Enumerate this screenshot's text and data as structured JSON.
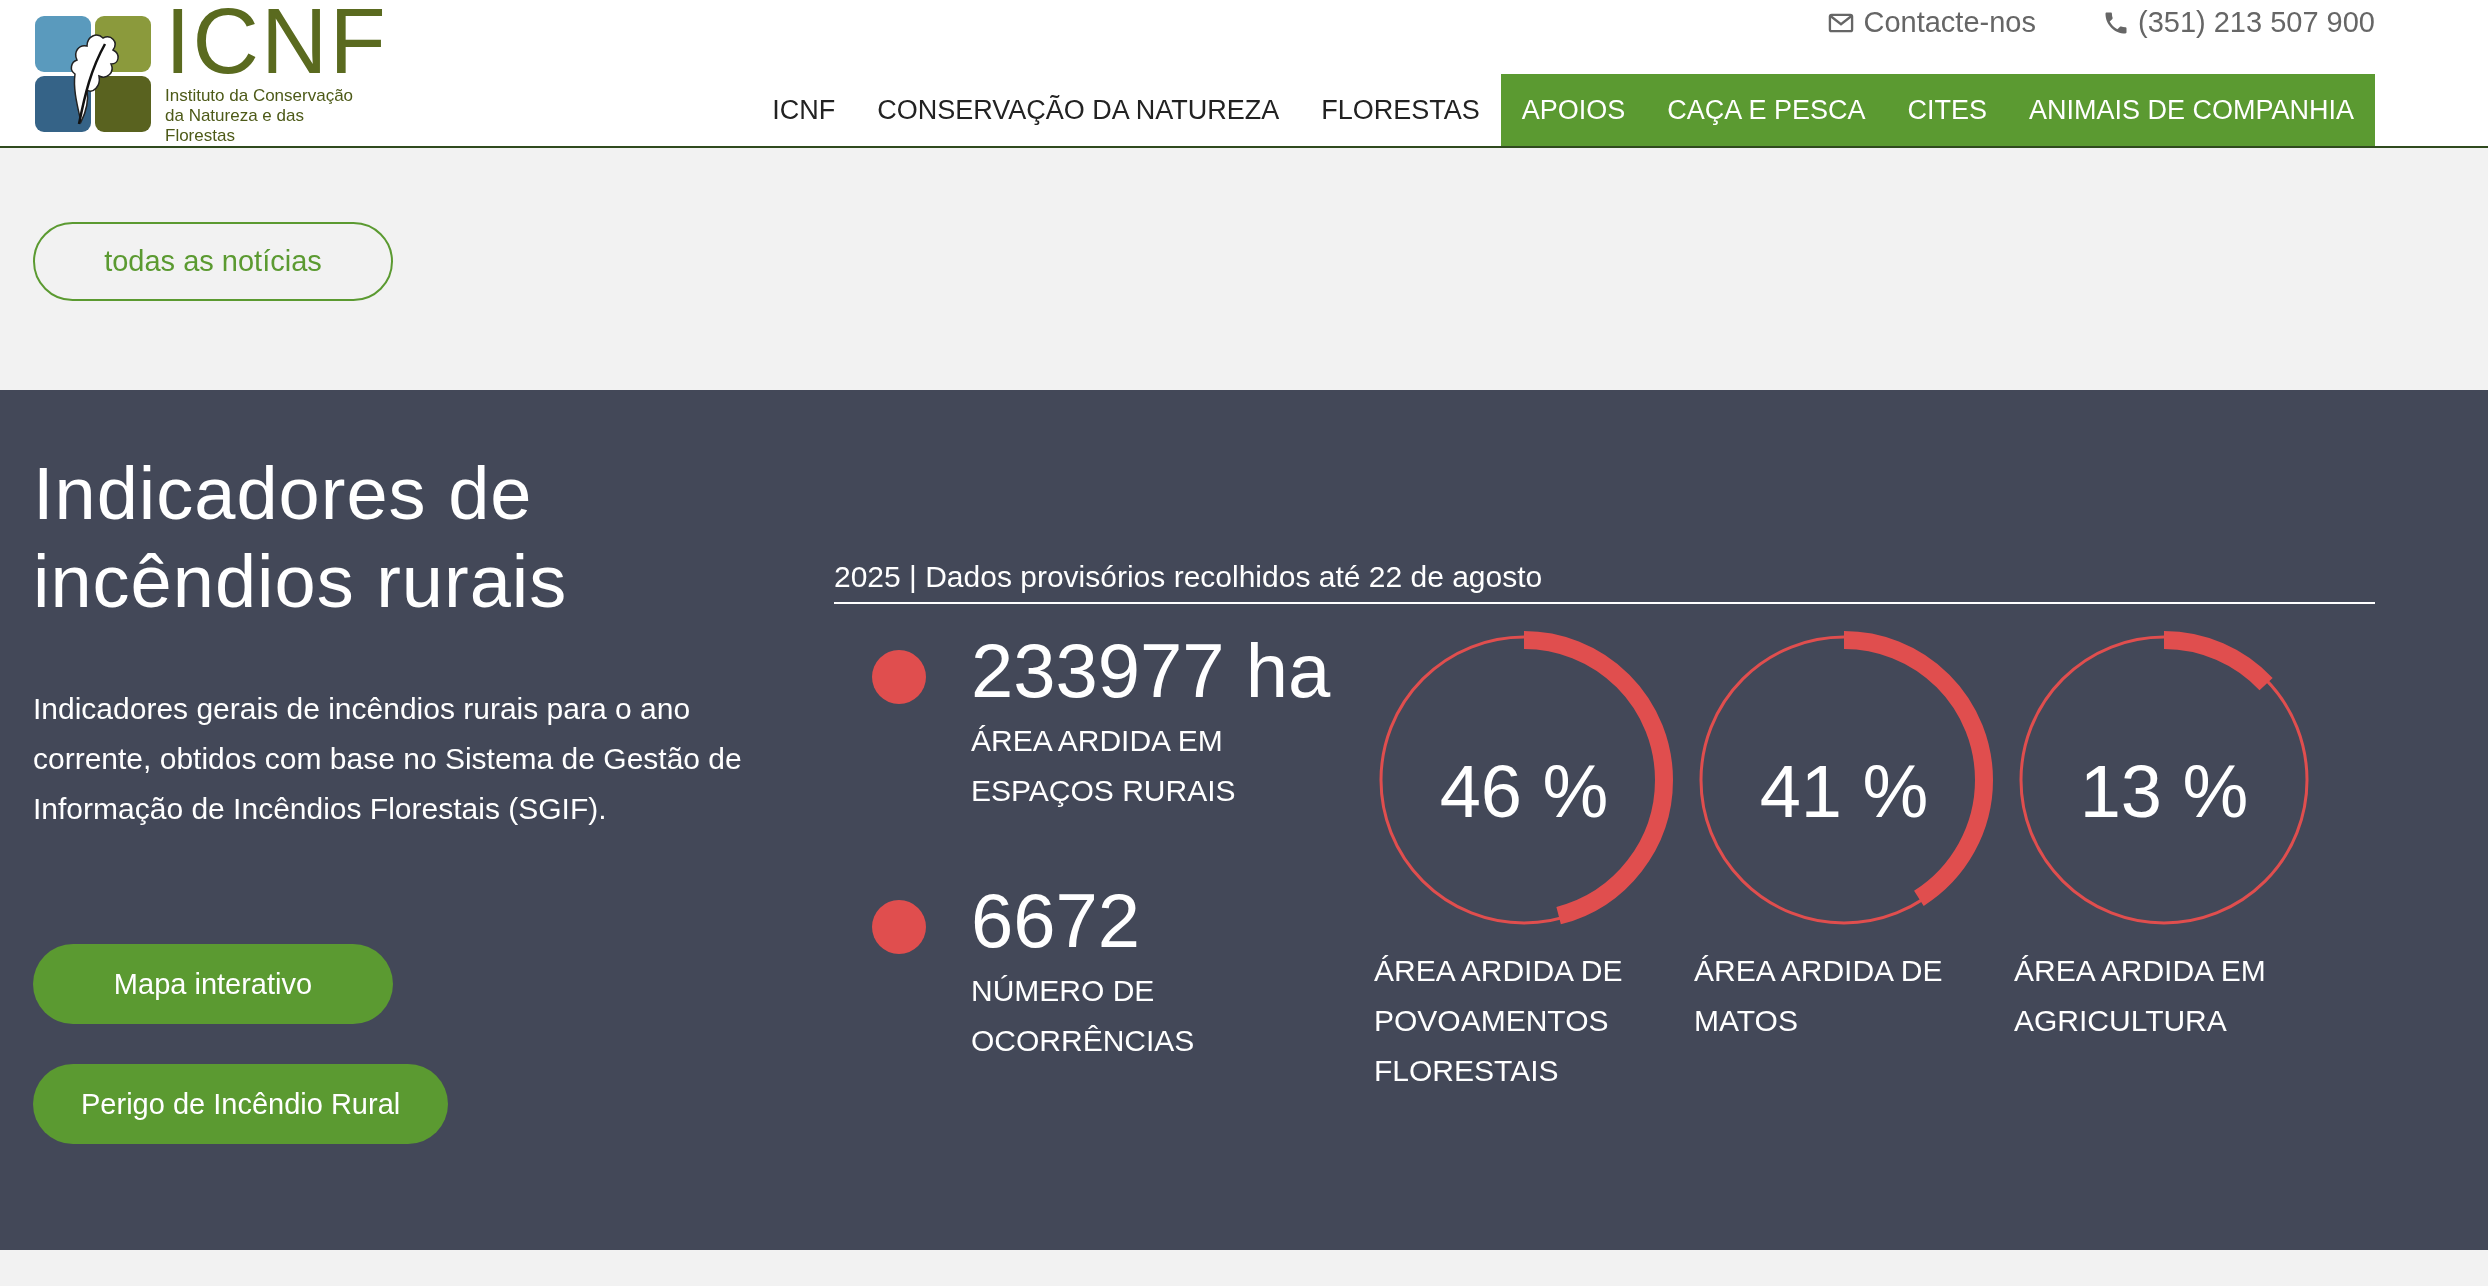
{
  "header": {
    "logo": {
      "acronym": "ICNF",
      "subtitle": "Instituto da Conservação da Natureza e das Florestas"
    },
    "contacts": [
      {
        "kind": "email",
        "label": "Contacte-nos"
      },
      {
        "kind": "phone",
        "label": "(351) 213 507 900"
      }
    ],
    "nav": [
      {
        "label": "ICNF",
        "highlighted": false
      },
      {
        "label": "CONSERVAÇÃO DA NATUREZA",
        "highlighted": false
      },
      {
        "label": "FLORESTAS",
        "highlighted": false
      },
      {
        "label": "APOIOS",
        "highlighted": true
      },
      {
        "label": "CAÇA E PESCA",
        "highlighted": true
      },
      {
        "label": "CITES",
        "highlighted": true
      },
      {
        "label": "ANIMAIS DE COMPANHIA",
        "highlighted": true
      }
    ]
  },
  "news": {
    "button": "todas as notícias"
  },
  "indicators": {
    "title": "Indicadores de incêndios rurais",
    "description": "Indicadores gerais de incêndios rurais para o ano corrente, obtidos com base no Sistema de Gestão de Informação de Incêndios Florestais (SGIF).",
    "buttons": [
      "Mapa interativo",
      "Perigo de Incêndio Rural"
    ],
    "subtitle": "2025 | Dados provisórios recolhidos até 22 de agosto",
    "stats": [
      {
        "value": "233977 ha",
        "label": "ÁREA ARDIDA EM ESPAÇOS RURAIS"
      },
      {
        "value": "6672",
        "label": "NÚMERO DE OCORRÊNCIAS"
      }
    ],
    "gauges": [
      {
        "reading": "46 %",
        "level": 0.46,
        "label": "ÁREA ARDIDA DE POVOAMENTOS FLORESTAIS"
      },
      {
        "reading": "41 %",
        "level": 0.41,
        "label": "ÁREA ARDIDA DE MATOS"
      },
      {
        "reading": "13 %",
        "level": 0.13,
        "label": "ÁREA ARDIDA EM AGRICULTURA"
      }
    ]
  }
}
